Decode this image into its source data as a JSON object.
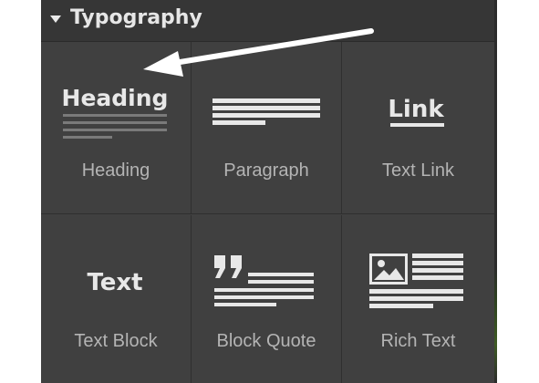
{
  "section": {
    "title": "Typography",
    "collapse_icon": "caret-down-icon"
  },
  "elements": [
    {
      "label": "Heading",
      "icon": "heading-icon",
      "icon_text": "Heading"
    },
    {
      "label": "Paragraph",
      "icon": "paragraph-icon"
    },
    {
      "label": "Text Link",
      "icon": "link-icon",
      "icon_text": "Link"
    },
    {
      "label": "Text Block",
      "icon": "text-block-icon",
      "icon_text": "Text"
    },
    {
      "label": "Block Quote",
      "icon": "block-quote-icon"
    },
    {
      "label": "Rich Text",
      "icon": "rich-text-icon"
    }
  ],
  "annotation": {
    "icon": "arrow-annotation"
  },
  "colors": {
    "panel": "#404040",
    "header": "#363636",
    "label": "#b4b4b4",
    "icon": "#e8e8e8",
    "arrow": "#ffffff"
  }
}
